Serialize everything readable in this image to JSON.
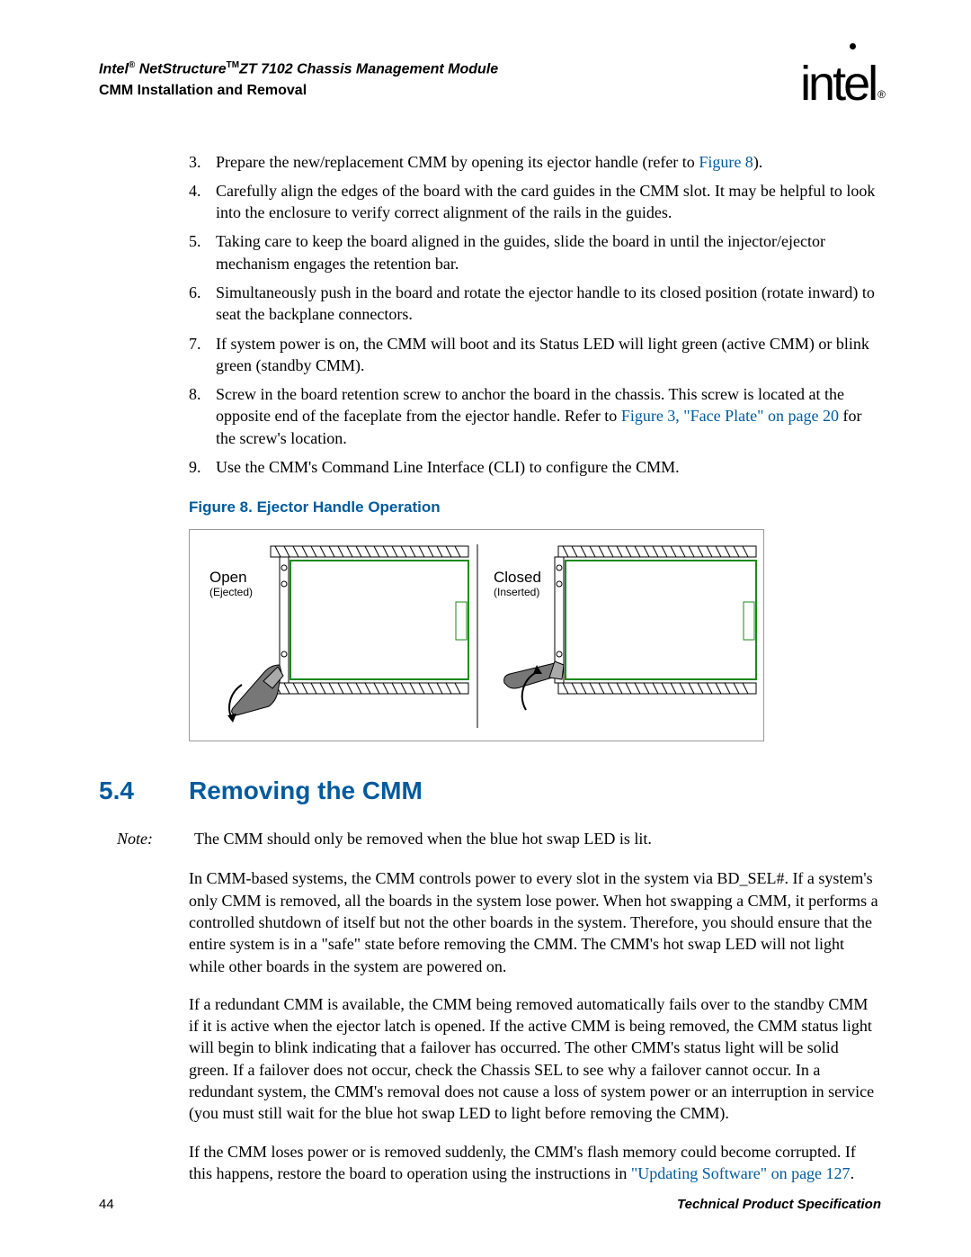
{
  "header": {
    "doc_title_html": "Intel<span class='reg'>®</span> NetStructure<span class='tm'>TM</span>ZT 7102 Chassis Management Module",
    "doc_subtitle": "CMM Installation and Removal",
    "logo_text": "intel",
    "logo_reg": "®"
  },
  "steps": [
    {
      "pre": "Prepare the new/replacement CMM by opening its ejector handle (refer to ",
      "link": "Figure 8",
      "post": ")."
    },
    {
      "pre": "Carefully align the edges of the board with the card guides in the CMM slot. It may be helpful to look into the enclosure to verify correct alignment of the rails in the guides."
    },
    {
      "pre": "Taking care to keep the board aligned in the guides, slide the board in until the injector/ejector mechanism engages the retention bar."
    },
    {
      "pre": "Simultaneously push in the board and rotate the ejector handle to its closed position (rotate inward) to seat the backplane connectors."
    },
    {
      "pre": "If system power is on, the CMM will boot and its Status LED will light green (active CMM) or blink green (standby CMM)."
    },
    {
      "pre": "Screw in the board retention screw to anchor the board in the chassis. This screw is located at the opposite end of the faceplate from the ejector handle. Refer to ",
      "link": "Figure 3, \"Face Plate\" on page 20",
      "post": " for the screw's location."
    },
    {
      "pre": "Use the CMM's Command Line Interface (CLI) to configure the CMM."
    }
  ],
  "figure": {
    "caption": "Figure 8. Ejector Handle Operation",
    "left_label": "Open",
    "left_sub": "(Ejected)",
    "right_label": "Closed",
    "right_sub": "(Inserted)"
  },
  "section": {
    "number": "5.4",
    "title": "Removing the CMM"
  },
  "note_label": "Note:",
  "note_body": "The CMM should only be removed when the blue hot swap LED is lit.",
  "paragraphs": {
    "p1": "In CMM-based systems, the CMM controls power to every slot in the system via BD_SEL#. If a system's only CMM is removed, all the boards in the system lose power. When hot swapping a CMM, it performs a controlled shutdown of itself but not the other boards in the system. Therefore, you should ensure that the entire system is in a \"safe\" state before removing the CMM. The CMM's hot swap LED will not light while other boards in the system are powered on.",
    "p2": "If a redundant CMM is available, the CMM being removed automatically fails over to the standby CMM if it is active when the ejector latch is opened. If the active CMM is being removed, the CMM status light will begin to blink indicating that a failover has occurred. The other CMM's status light will be solid green. If a failover does not occur, check the Chassis SEL to see why a failover cannot occur.   In a redundant system, the CMM's removal does not cause a loss of system power or an interruption in service (you must still wait for the blue hot swap LED to light before removing the CMM).",
    "p3_pre": "If the CMM loses power or is removed suddenly, the CMM's flash memory could become corrupted. If this happens, restore the board to operation using the instructions in ",
    "p3_link": "\"Updating Software\" on page 127",
    "p3_post": "."
  },
  "footer": {
    "page": "44",
    "spec": "Technical Product Specification"
  }
}
